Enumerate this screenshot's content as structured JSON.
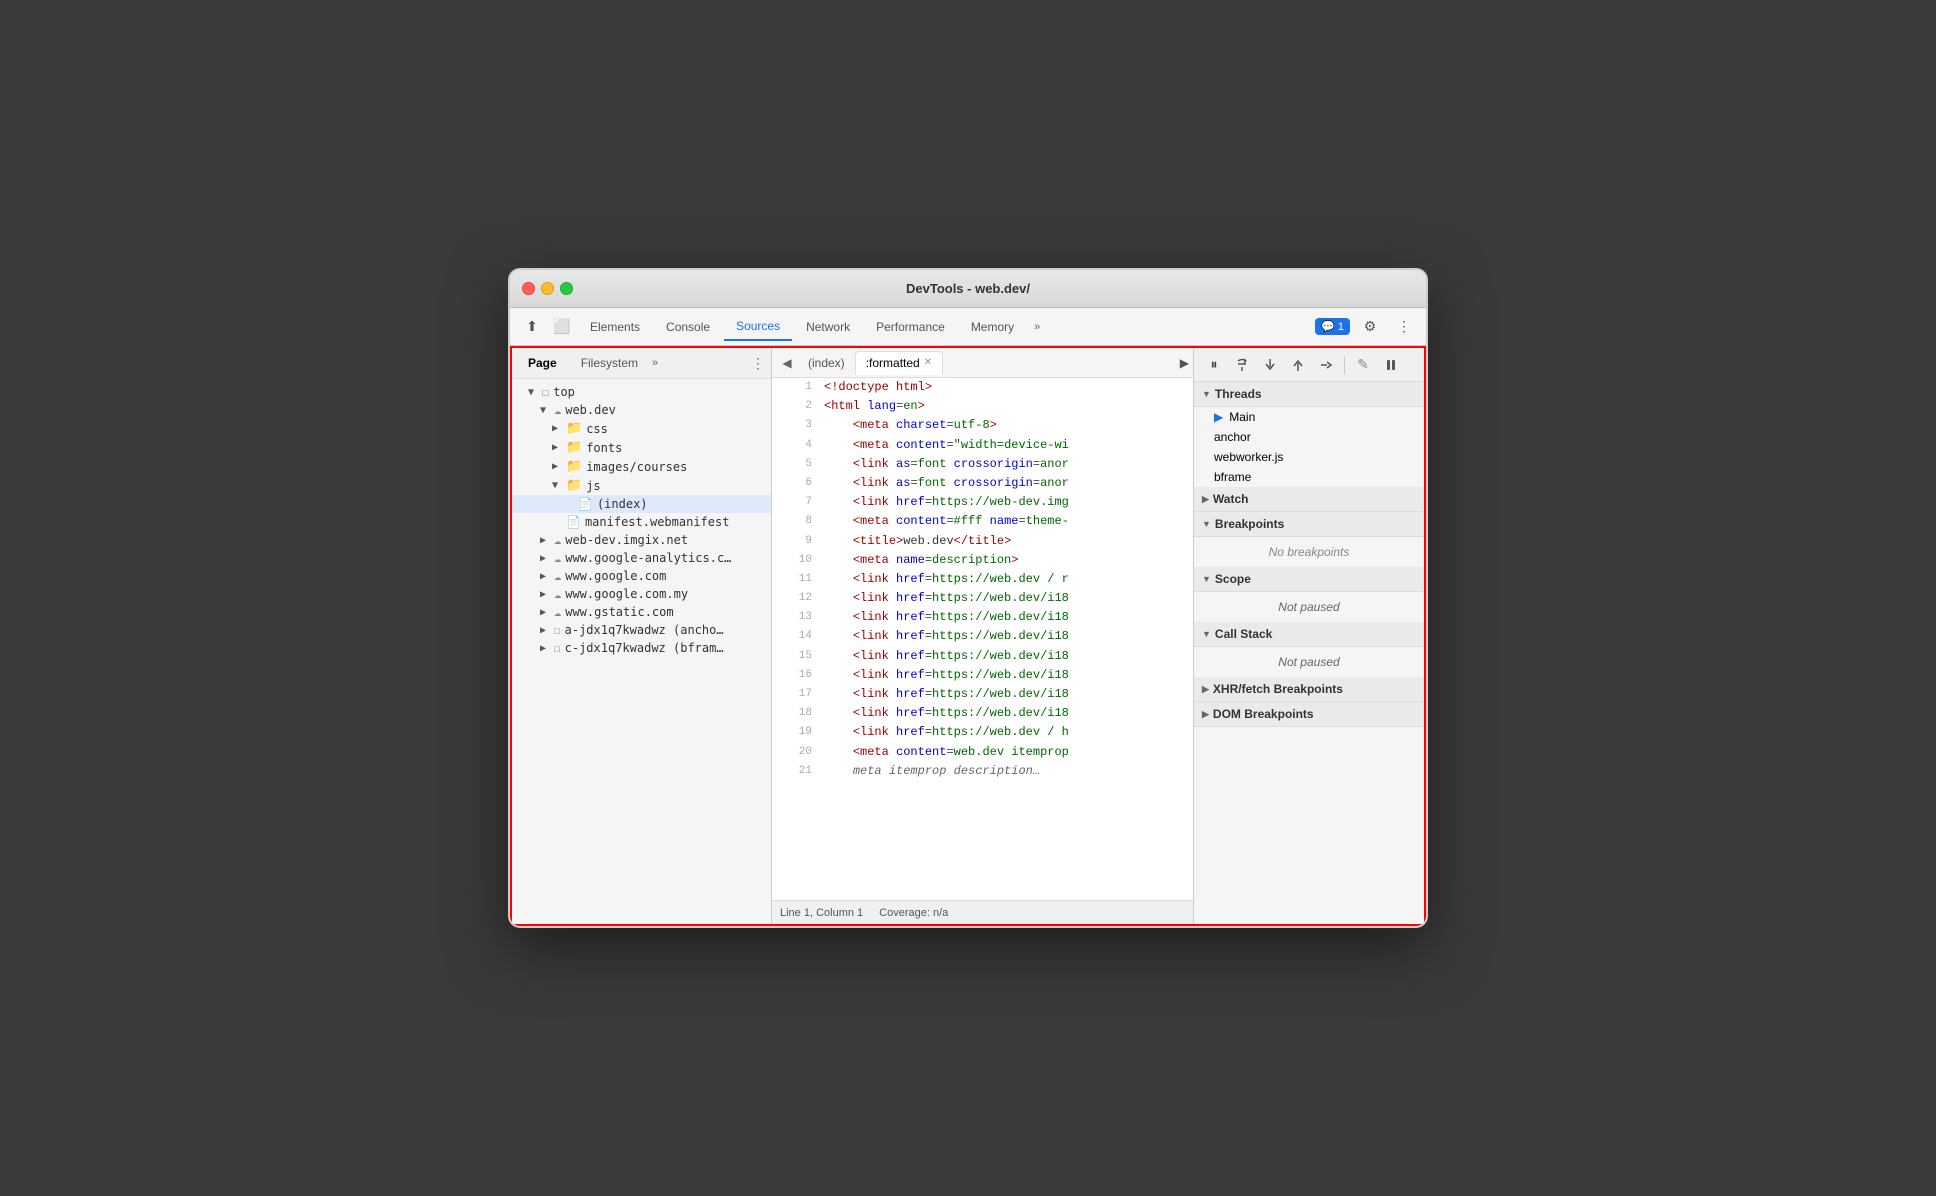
{
  "window": {
    "title": "DevTools - web.dev/"
  },
  "devtools_tabs": {
    "items": [
      "Elements",
      "Console",
      "Sources",
      "Network",
      "Performance",
      "Memory"
    ],
    "active": "Sources",
    "more_label": "»",
    "notification": "💬 1",
    "settings_icon": "⚙",
    "menu_icon": "⋮"
  },
  "left_panel": {
    "tabs": [
      "Page",
      "Filesystem"
    ],
    "active_tab": "Page",
    "more_label": "»",
    "menu_icon": "⋮",
    "tree": [
      {
        "label": "top",
        "indent": 0,
        "type": "folder-open",
        "icon": "folder-outline"
      },
      {
        "label": "web.dev",
        "indent": 1,
        "type": "folder-open",
        "icon": "cloud"
      },
      {
        "label": "css",
        "indent": 2,
        "type": "folder",
        "icon": "folder"
      },
      {
        "label": "fonts",
        "indent": 2,
        "type": "folder",
        "icon": "folder"
      },
      {
        "label": "images/courses",
        "indent": 2,
        "type": "folder",
        "icon": "folder"
      },
      {
        "label": "js",
        "indent": 2,
        "type": "folder-open",
        "icon": "folder"
      },
      {
        "label": "(index)",
        "indent": 3,
        "type": "file",
        "icon": "file",
        "selected": true
      },
      {
        "label": "manifest.webmanifest",
        "indent": 2,
        "type": "file",
        "icon": "file"
      },
      {
        "label": "web-dev.imgix.net",
        "indent": 1,
        "type": "folder",
        "icon": "cloud"
      },
      {
        "label": "www.google-analytics.c…",
        "indent": 1,
        "type": "folder",
        "icon": "cloud"
      },
      {
        "label": "www.google.com",
        "indent": 1,
        "type": "folder",
        "icon": "cloud"
      },
      {
        "label": "www.google.com.my",
        "indent": 1,
        "type": "folder",
        "icon": "cloud"
      },
      {
        "label": "www.gstatic.com",
        "indent": 1,
        "type": "folder",
        "icon": "cloud"
      },
      {
        "label": "a-jdx1q7kwadwz (ancho…",
        "indent": 1,
        "type": "folder",
        "icon": "square"
      },
      {
        "label": "c-jdx1q7kwadwz (bfram…",
        "indent": 1,
        "type": "folder",
        "icon": "square"
      }
    ]
  },
  "editor": {
    "tabs": [
      {
        "label": "(index)",
        "active": false
      },
      {
        "label": ":formatted",
        "active": true,
        "closeable": true
      }
    ],
    "lines": [
      {
        "num": 1,
        "html": "<span class='c-tag'>&lt;!doctype html&gt;</span>"
      },
      {
        "num": 2,
        "html": "<span class='c-tag'>&lt;html</span> <span class='c-attr'>lang</span><span class='c-eq'>=</span><span class='c-green'>en</span><span class='c-tag'>&gt;</span>"
      },
      {
        "num": 3,
        "html": "    <span class='c-tag'>&lt;meta</span> <span class='c-attr'>charset</span><span class='c-eq'>=</span><span class='c-green'>utf-8</span><span class='c-tag'>&gt;</span>"
      },
      {
        "num": 4,
        "html": "    <span class='c-tag'>&lt;meta</span> <span class='c-attr'>content</span><span class='c-eq'>=</span><span class='c-green'>\"width=device-wi</span>"
      },
      {
        "num": 5,
        "html": "    <span class='c-tag'>&lt;link</span> <span class='c-attr'>as</span><span class='c-eq'>=</span><span class='c-green'>font</span> <span class='c-attr'>crossorigin</span><span class='c-eq'>=</span><span class='c-green'>anor</span>"
      },
      {
        "num": 6,
        "html": "    <span class='c-tag'>&lt;link</span> <span class='c-attr'>as</span><span class='c-eq'>=</span><span class='c-green'>font</span> <span class='c-attr'>crossorigin</span><span class='c-eq'>=</span><span class='c-green'>anor</span>"
      },
      {
        "num": 7,
        "html": "    <span class='c-tag'>&lt;link</span> <span class='c-attr'>href</span><span class='c-eq'>=</span><span class='c-green'>https://web-dev.img</span>"
      },
      {
        "num": 8,
        "html": "    <span class='c-tag'>&lt;meta</span> <span class='c-attr'>content</span><span class='c-eq'>=</span><span class='c-green'>#fff</span> <span class='c-attr'>name</span><span class='c-eq'>=</span><span class='c-green'>theme-</span>"
      },
      {
        "num": 9,
        "html": "    <span class='c-tag'>&lt;title&gt;</span><span class='c-text'>web.dev</span><span class='c-tag'>&lt;/title&gt;</span>"
      },
      {
        "num": 10,
        "html": "    <span class='c-tag'>&lt;meta</span> <span class='c-attr'>name</span><span class='c-eq'>=</span><span class='c-green'>description</span><span class='c-tag'>&gt;</span>"
      },
      {
        "num": 11,
        "html": "    <span class='c-tag'>&lt;link</span> <span class='c-attr'>href</span><span class='c-eq'>=</span><span class='c-green'>https://web.dev / r</span>"
      },
      {
        "num": 12,
        "html": "    <span class='c-tag'>&lt;link</span> <span class='c-attr'>href</span><span class='c-eq'>=</span><span class='c-green'>https://web.dev/i18</span>"
      },
      {
        "num": 13,
        "html": "    <span class='c-tag'>&lt;link</span> <span class='c-attr'>href</span><span class='c-eq'>=</span><span class='c-green'>https://web.dev/i18</span>"
      },
      {
        "num": 14,
        "html": "    <span class='c-tag'>&lt;link</span> <span class='c-attr'>href</span><span class='c-eq'>=</span><span class='c-green'>https://web.dev/i18</span>"
      },
      {
        "num": 15,
        "html": "    <span class='c-tag'>&lt;link</span> <span class='c-attr'>href</span><span class='c-eq'>=</span><span class='c-green'>https://web.dev/i18</span>"
      },
      {
        "num": 16,
        "html": "    <span class='c-tag'>&lt;link</span> <span class='c-attr'>href</span><span class='c-eq'>=</span><span class='c-green'>https://web.dev/i18</span>"
      },
      {
        "num": 17,
        "html": "    <span class='c-tag'>&lt;link</span> <span class='c-attr'>href</span><span class='c-eq'>=</span><span class='c-green'>https://web.dev/i18</span>"
      },
      {
        "num": 18,
        "html": "    <span class='c-tag'>&lt;link</span> <span class='c-attr'>href</span><span class='c-eq'>=</span><span class='c-green'>https://web.dev/i18</span>"
      },
      {
        "num": 19,
        "html": "    <span class='c-tag'>&lt;link</span> <span class='c-attr'>href</span><span class='c-eq'>=</span><span class='c-green'>https://web.dev / h</span>"
      },
      {
        "num": 20,
        "html": "    <span class='c-tag'>&lt;meta</span> <span class='c-attr'>content</span><span class='c-eq'>=</span><span class='c-green'>web.dev itemprop</span>"
      }
    ],
    "footer": {
      "position": "Line 1, Column 1",
      "coverage": "Coverage: n/a"
    }
  },
  "right_panel": {
    "toolbar": {
      "buttons": [
        {
          "icon": "⏸",
          "label": "pause"
        },
        {
          "icon": "↺",
          "label": "step-over"
        },
        {
          "icon": "↓",
          "label": "step-into"
        },
        {
          "icon": "↑",
          "label": "step-out"
        },
        {
          "icon": "⇢",
          "label": "step"
        },
        {
          "icon": "✎",
          "label": "deactivate"
        },
        {
          "icon": "⏸",
          "label": "pause-on-exceptions"
        }
      ]
    },
    "sections": [
      {
        "id": "threads",
        "label": "Threads",
        "expanded": true,
        "items": [
          {
            "label": "Main",
            "arrow": true
          },
          {
            "label": "anchor",
            "arrow": false
          },
          {
            "label": "webworker.js",
            "arrow": false
          },
          {
            "label": "bframe",
            "arrow": false
          }
        ]
      },
      {
        "id": "watch",
        "label": "Watch",
        "expanded": false,
        "items": []
      },
      {
        "id": "breakpoints",
        "label": "Breakpoints",
        "expanded": true,
        "empty_message": "No breakpoints"
      },
      {
        "id": "scope",
        "label": "Scope",
        "expanded": true,
        "not_paused": true,
        "not_paused_message": "Not paused"
      },
      {
        "id": "call-stack",
        "label": "Call Stack",
        "expanded": true,
        "not_paused": true,
        "not_paused_message": "Not paused"
      },
      {
        "id": "xhr-breakpoints",
        "label": "XHR/fetch Breakpoints",
        "expanded": false
      },
      {
        "id": "dom-breakpoints",
        "label": "DOM Breakpoints",
        "expanded": false
      }
    ]
  }
}
